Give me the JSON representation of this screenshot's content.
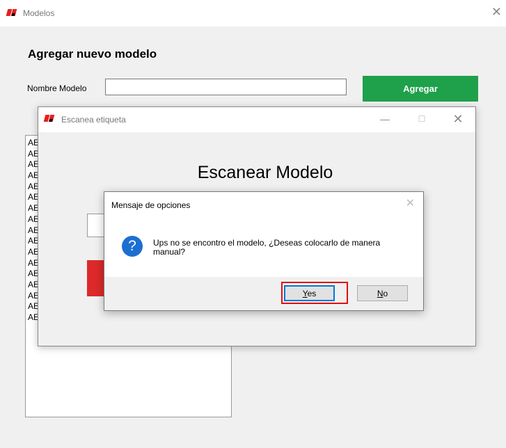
{
  "main_window": {
    "title": "Modelos",
    "close_glyph": "✕",
    "form_heading": "Agregar nuevo modelo",
    "model_name_label": "Nombre Modelo",
    "model_name_value": "",
    "add_button_label": "Agregar",
    "models_list": [
      "AE",
      "AE",
      "AE",
      "AE",
      "AE",
      "AE",
      "AE",
      "AE",
      "AE",
      "AE",
      "AE",
      "AE",
      "AE",
      "AE",
      "AE",
      "AE",
      "AE"
    ]
  },
  "scan_window": {
    "title": "Escanea etiqueta",
    "minimize_glyph": "—",
    "maximize_glyph": "☐",
    "close_glyph": "✕",
    "heading": "Escanear Modelo",
    "scan_input_value": ""
  },
  "message_dialog": {
    "title": "Mensaje de opciones",
    "close_glyph": "✕",
    "icon": "question-icon",
    "icon_glyph": "?",
    "message": "Ups no se encontro el modelo, ¿Deseas colocarlo de manera manual?",
    "yes_mnemonic": "Y",
    "yes_rest": "es",
    "no_mnemonic": "N",
    "no_rest": "o"
  },
  "colors": {
    "add_button": "#1ea14a",
    "scan_red_button": "#dd2929",
    "question_icon": "#1c6fd1",
    "highlight": "#e01010"
  }
}
